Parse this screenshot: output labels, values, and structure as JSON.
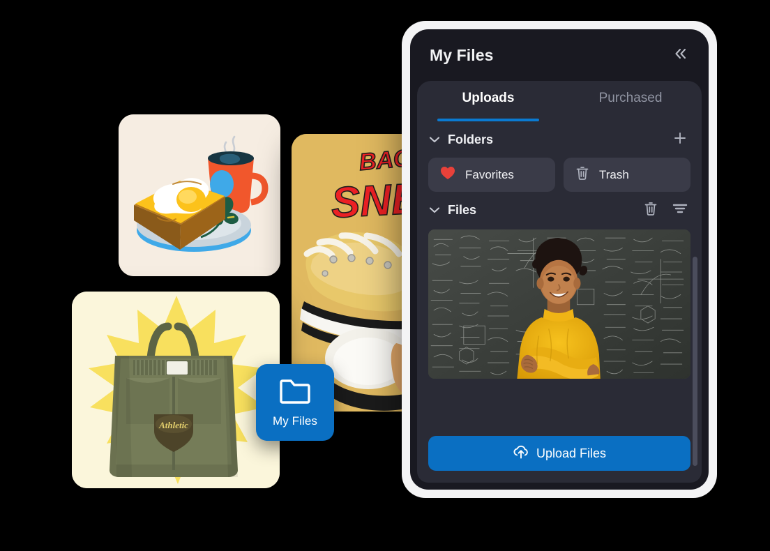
{
  "theme": {
    "page_background": "#000000",
    "shell_background": "#f4f4f5",
    "panel_background": "#191921",
    "panel_body_background": "#2a2b36",
    "chip_background": "#3a3b48",
    "accent_blue": "#0a6fc2",
    "tab_underline_blue": "#0a7ad1",
    "favorite_red": "#e8413a",
    "text_primary": "#f2f3f5",
    "text_muted": "#9195a3"
  },
  "fab": {
    "label": "My Files",
    "icon": "folder-icon",
    "background": "#0a6fc2"
  },
  "panel": {
    "header": {
      "title": "My Files",
      "collapse_icon": "chevron-double-left-icon"
    },
    "tabs": [
      {
        "label": "Uploads",
        "active": true
      },
      {
        "label": "Purchased",
        "active": false
      }
    ],
    "sections": [
      {
        "id": "folders",
        "title": "Folders",
        "expanded": true,
        "collapse_icon": "chevron-down-icon",
        "actions": [
          {
            "name": "add-folder-button",
            "icon": "plus-icon"
          }
        ],
        "chips": [
          {
            "label": "Favorites",
            "icon": "heart-icon",
            "icon_color": "#e8413a"
          },
          {
            "label": "Trash",
            "icon": "trash-icon",
            "icon_color": "#aeb2be"
          }
        ]
      },
      {
        "id": "files",
        "title": "Files",
        "expanded": true,
        "collapse_icon": "chevron-down-icon",
        "actions": [
          {
            "name": "delete-files-button",
            "icon": "trash-icon"
          },
          {
            "name": "filter-files-button",
            "icon": "filter-icon"
          }
        ],
        "files": [
          {
            "name": "chalkboard-photo-thumbnail",
            "description": "Smiling child in a yellow turtleneck standing in front of a chalkboard covered in handwritten math and chemistry formulas"
          }
        ]
      }
    ],
    "footer": {
      "upload_label": "Upload Files",
      "upload_icon": "cloud-upload-icon"
    },
    "scrollbar": {
      "name": "panel-scrollbar"
    }
  },
  "background_cards": [
    {
      "id": "breakfast",
      "name": "breakfast-illustration-card",
      "description": "Flat illustration of a fried egg on toast with a plate, herb sprig and a steaming orange coffee mug",
      "background": "#f6ede2"
    },
    {
      "id": "sneaker",
      "name": "sneaker-poster-card",
      "description": "Yellow poster with red graffiti lettering and a yellow high-top canvas sneaker",
      "background": "#e0b960",
      "poster_text_line1": "BACK",
      "poster_text_line2": "SNE"
    },
    {
      "id": "tote",
      "name": "tote-bag-card",
      "description": "Olive green canvas tote bag with Athletic shield badge on a cream background with a yellow starburst",
      "background": "#fbf6db",
      "badge_text": "Athletic"
    }
  ]
}
